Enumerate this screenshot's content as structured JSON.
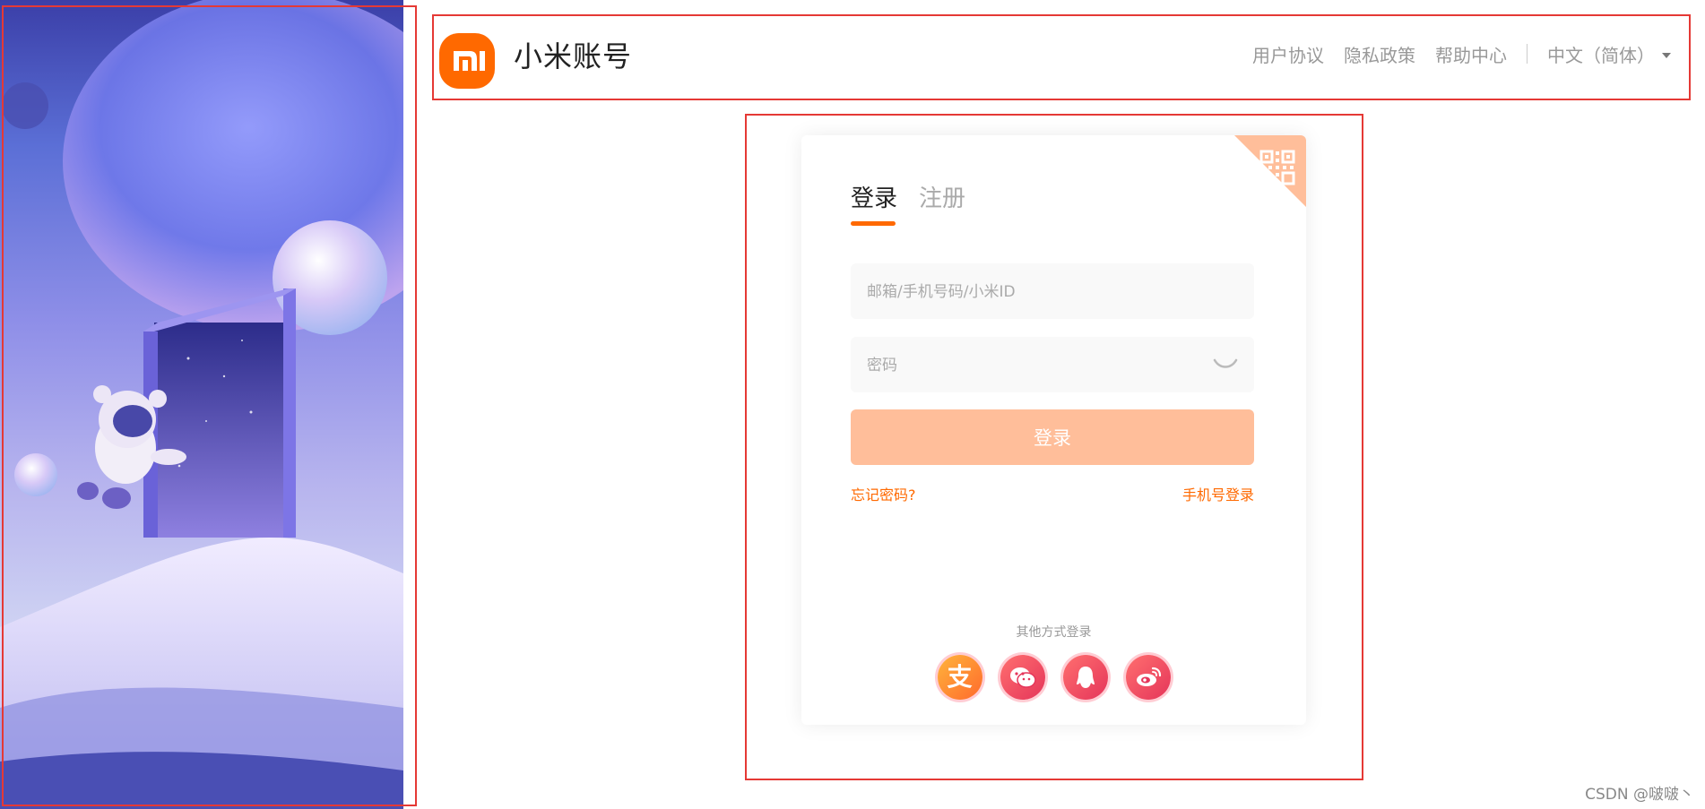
{
  "header": {
    "logo_text": "mi",
    "title": "小米账号",
    "nav": [
      "用户协议",
      "隐私政策",
      "帮助中心"
    ],
    "language": "中文（简体）"
  },
  "login": {
    "tabs": [
      {
        "label": "登录",
        "active": true
      },
      {
        "label": "注册",
        "active": false
      }
    ],
    "account_placeholder": "邮箱/手机号码/小米ID",
    "password_placeholder": "密码",
    "submit_label": "登录",
    "forgot_password": "忘记密码?",
    "phone_login": "手机号登录",
    "other_methods_title": "其他方式登录",
    "social_icons": [
      "alipay-icon",
      "wechat-icon",
      "qq-icon",
      "weibo-icon"
    ],
    "alipay_glyph": "支"
  },
  "watermark": "CSDN @啵啵丶",
  "colors": {
    "accent": "#ff6900",
    "button_disabled": "#ffbe9a",
    "annotation": "#e53935"
  }
}
